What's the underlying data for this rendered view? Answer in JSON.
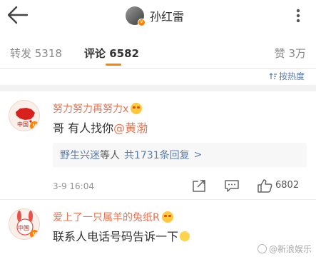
{
  "header": {
    "back_icon": "arrow-left-icon",
    "username": "孙红雷",
    "verified_badge": "v",
    "more_icon": "vertical-ellipsis-icon"
  },
  "tabs": {
    "forward": "转发 5318",
    "comment": "评论 6582",
    "like": "赞 3万",
    "active_color": "#ff8200"
  },
  "sort": {
    "label": "按热度",
    "icon": "sort-icon"
  },
  "comments": [
    {
      "name": "努力努力再努力x",
      "text": "哥 有人找你",
      "mention": "@黄渤",
      "reply": {
        "user": "野生兴迷",
        "mid": "等人",
        "count": "共1731条回复",
        "arrow": ">"
      },
      "date": "3-9 16:04",
      "like_count": "6802"
    },
    {
      "name": "爱上了一只属羊的兔纸R",
      "text": "联系人电话号码告诉一下"
    }
  ],
  "avatar_text": {
    "c1": "中国",
    "c2": "中国"
  },
  "watermark": {
    "text": "@新浪娱乐"
  },
  "colors": {
    "accent": "#ff8200",
    "name": "#eb7350",
    "link": "#5d7cab"
  }
}
